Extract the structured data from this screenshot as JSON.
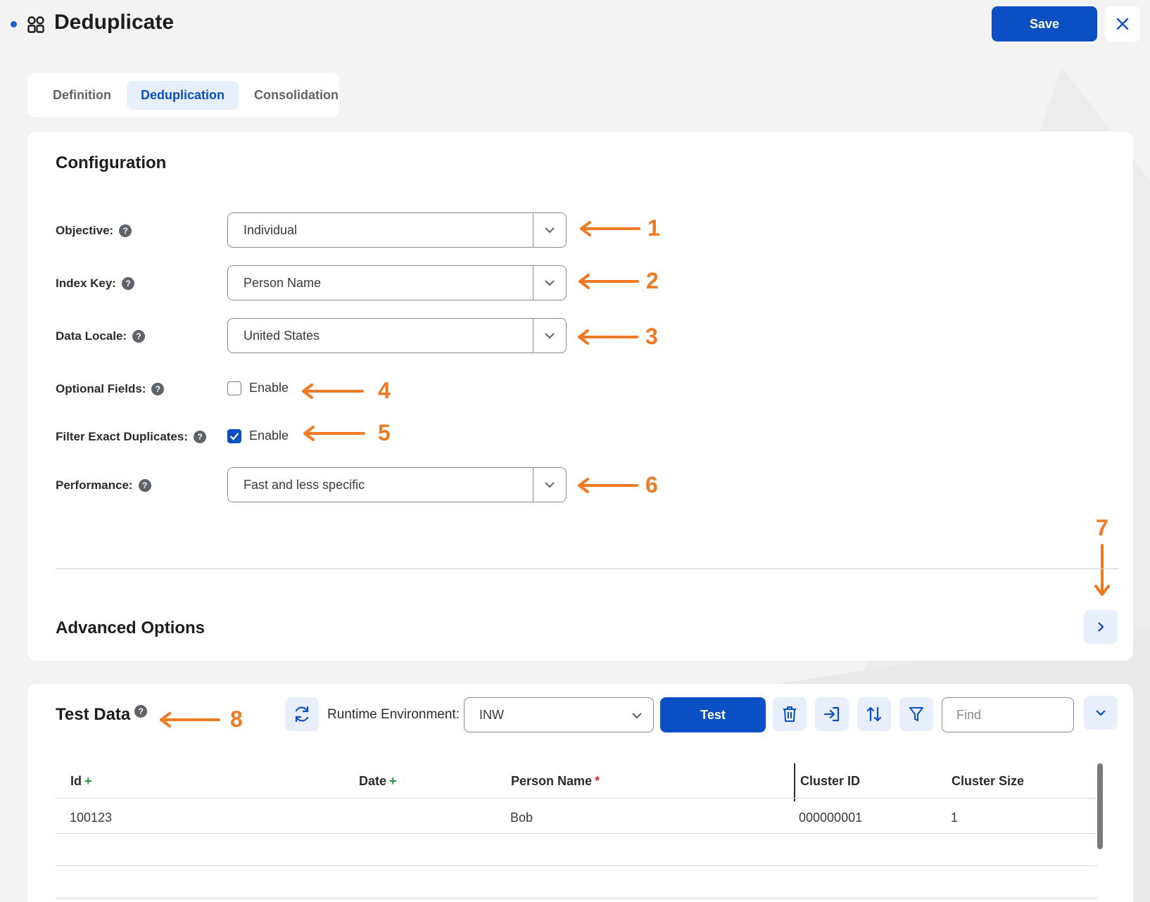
{
  "header": {
    "title": "Deduplicate",
    "save_label": "Save"
  },
  "tabs": [
    {
      "label": "Definition",
      "active": false
    },
    {
      "label": "Deduplication",
      "active": true
    },
    {
      "label": "Consolidation",
      "active": false
    }
  ],
  "configuration": {
    "title": "Configuration",
    "objective": {
      "label": "Objective:",
      "value": "Individual"
    },
    "index_key": {
      "label": "Index Key:",
      "value": "Person Name"
    },
    "data_locale": {
      "label": "Data Locale:",
      "value": "United States"
    },
    "optional_fields": {
      "label": "Optional Fields:",
      "checkbox_label": "Enable",
      "checked": false
    },
    "filter_exact_duplicates": {
      "label": "Filter Exact Duplicates:",
      "checkbox_label": "Enable",
      "checked": true
    },
    "performance": {
      "label": "Performance:",
      "value": "Fast and less specific"
    },
    "advanced_options": "Advanced Options"
  },
  "annotations": [
    "1",
    "2",
    "3",
    "4",
    "5",
    "6",
    "7",
    "8"
  ],
  "test_data": {
    "title": "Test Data",
    "runtime_label": "Runtime Environment:",
    "runtime_value": "INW",
    "test_label": "Test",
    "find_placeholder": "Find",
    "columns": [
      {
        "label": "Id",
        "marker": "+"
      },
      {
        "label": "Date",
        "marker": "+"
      },
      {
        "label": "Person Name",
        "marker": "*"
      },
      {
        "label": "Cluster ID",
        "marker": ""
      },
      {
        "label": "Cluster Size",
        "marker": ""
      }
    ],
    "rows": [
      [
        "100123",
        "",
        "Bob",
        "000000001",
        "1"
      ]
    ]
  },
  "colors": {
    "primary": "#0b4fc4",
    "annotation": "#ef7a22",
    "add_marker": "#1e9d3a",
    "required_marker": "#d32f2f"
  }
}
